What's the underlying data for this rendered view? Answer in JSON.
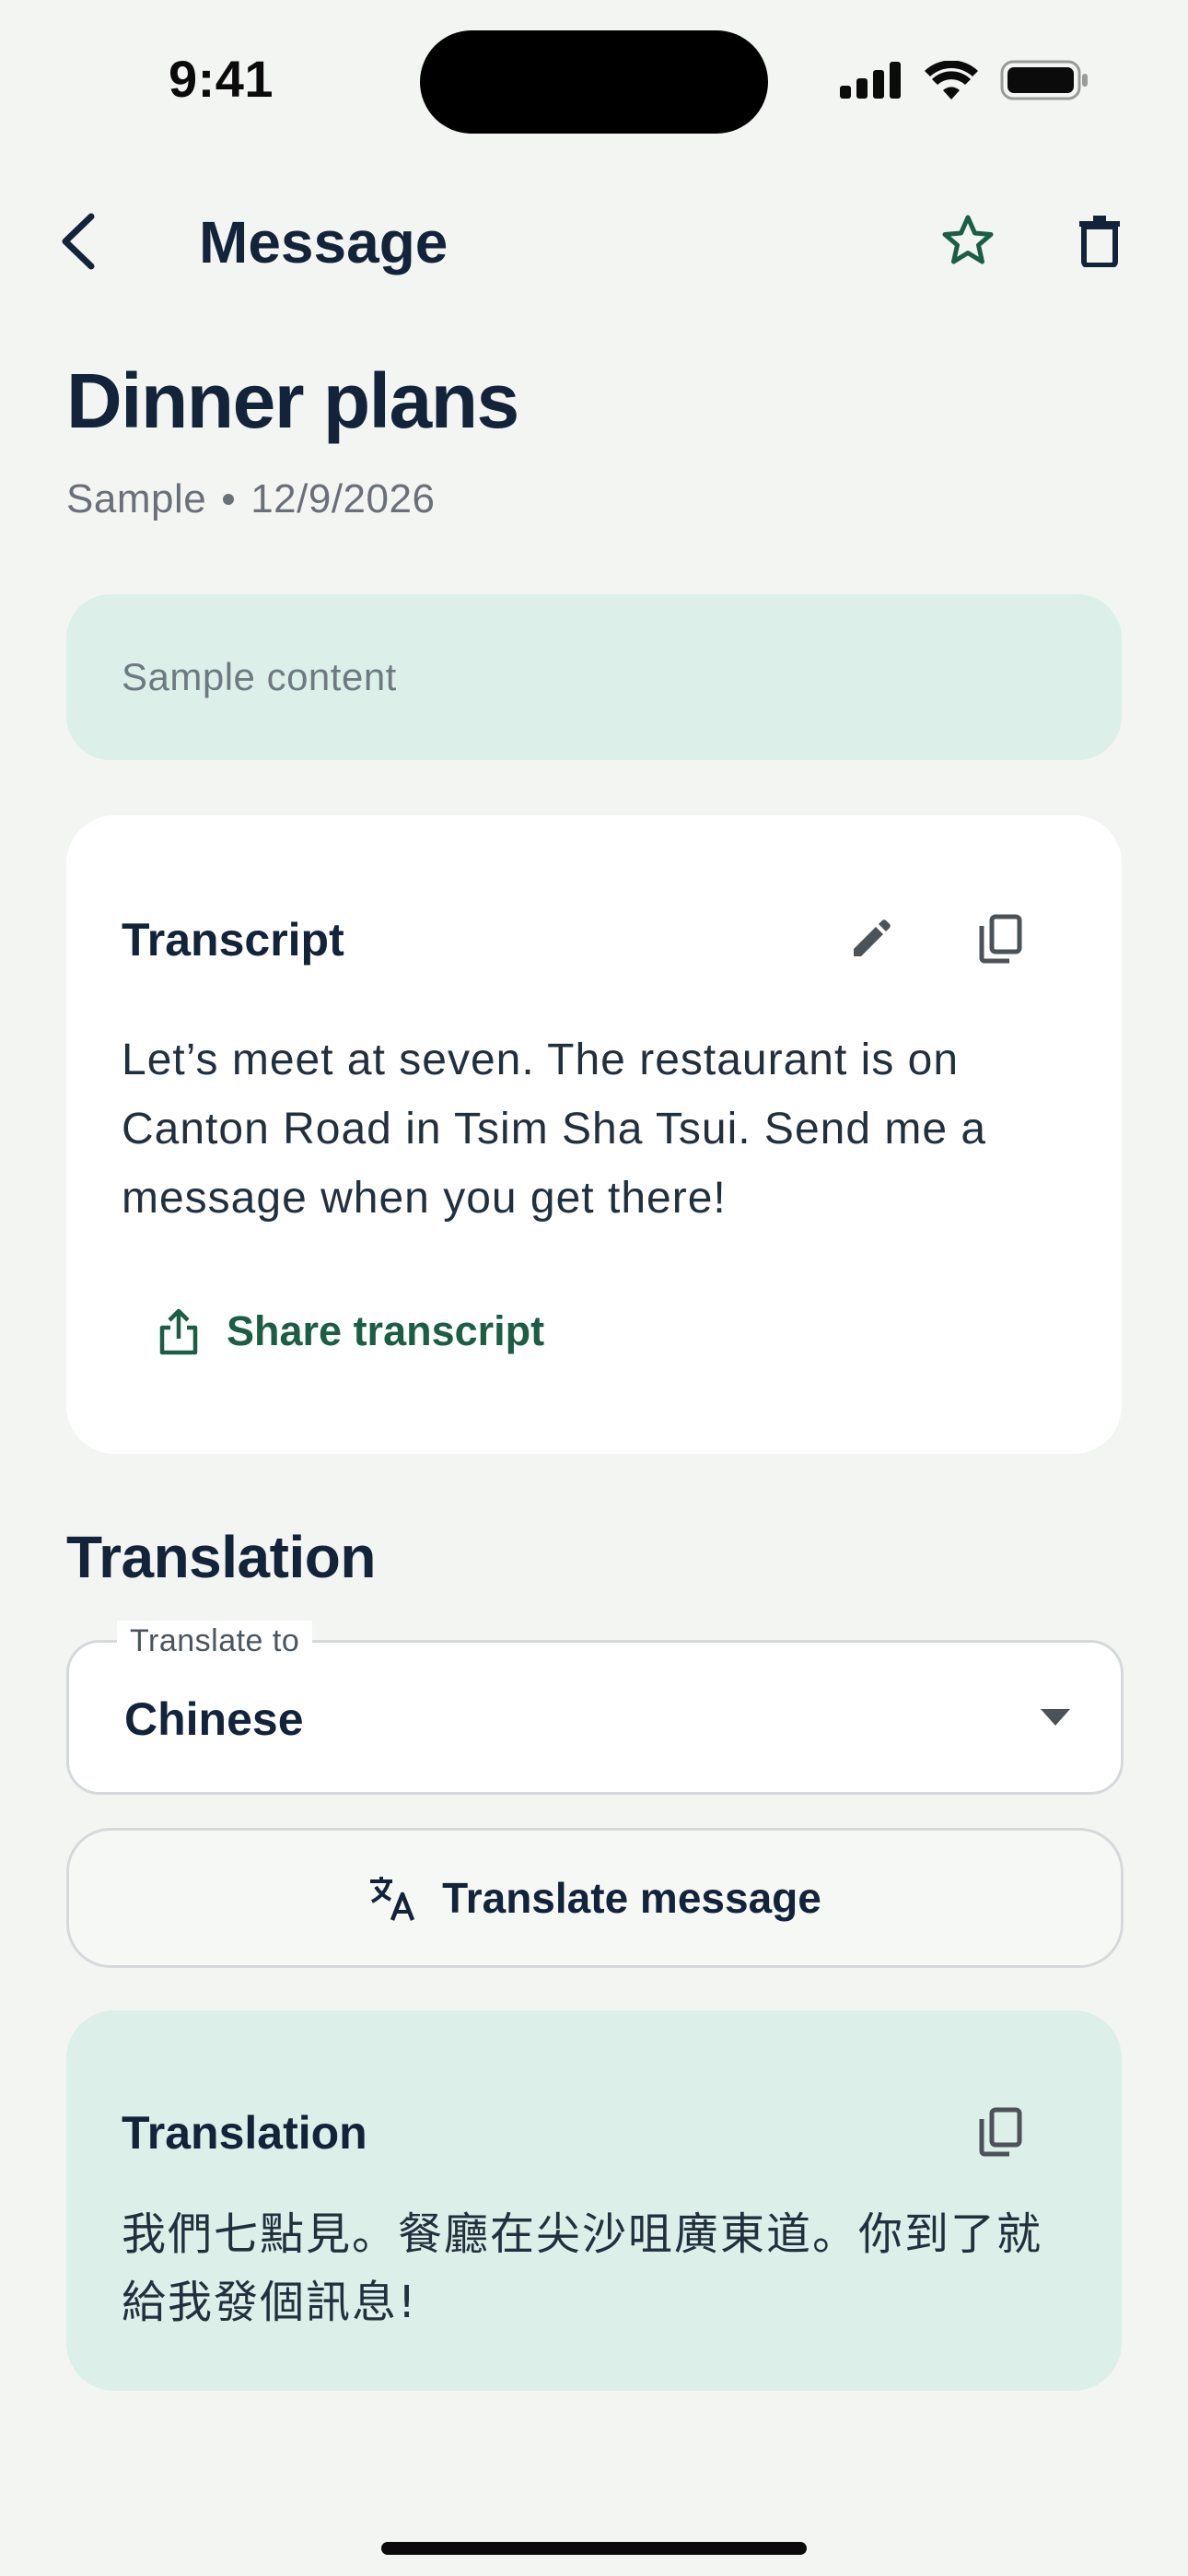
{
  "status_bar": {
    "time": "9:41"
  },
  "header": {
    "title": "Message",
    "back_icon": "chevron-left-icon",
    "star_icon": "star-outline-icon",
    "trash_icon": "trash-icon"
  },
  "message": {
    "title": "Dinner plans",
    "source": "Sample",
    "date": "12/9/2026",
    "sample_content": "Sample content"
  },
  "transcript": {
    "heading": "Transcript",
    "text": "Let’s meet at seven. The restaurant is on Canton Road in Tsim Sha Tsui. Send me a message when you get there!",
    "share_label": "Share transcript"
  },
  "translation_section": {
    "heading": "Translation",
    "select_label": "Translate to",
    "select_value": "Chinese",
    "translate_button": "Translate message"
  },
  "translation_result": {
    "heading": "Translation",
    "text": "我們七點見。餐廳在尖沙咀廣東道。你到了就給我發個訊息!"
  },
  "colors": {
    "background": "#f3f5f3",
    "accent_green": "#1b5e45",
    "mint_surface": "#dcefe8",
    "heading_navy": "#13233a"
  }
}
